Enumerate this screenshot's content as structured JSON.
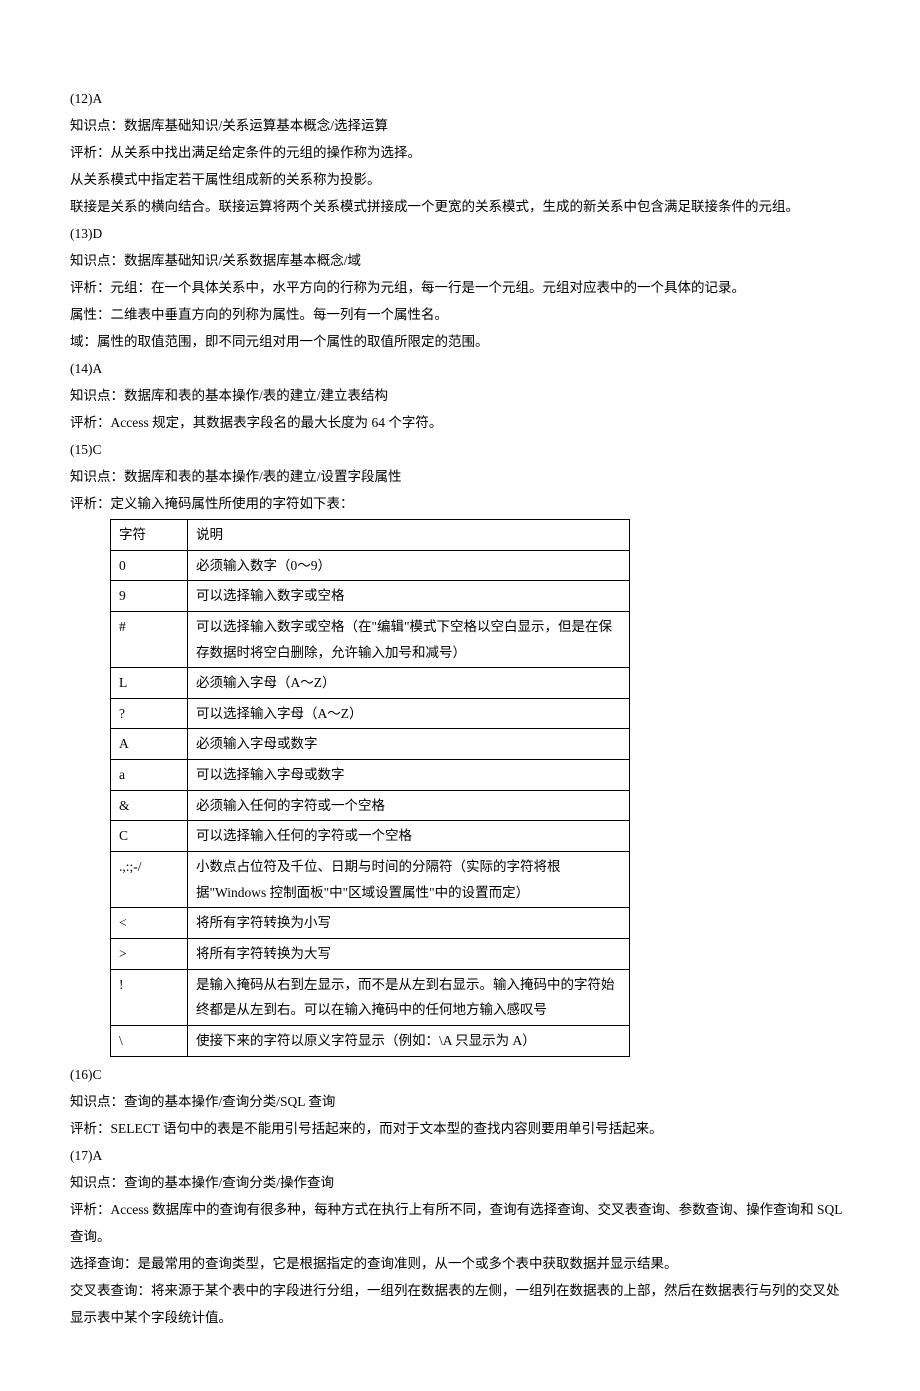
{
  "paragraphs_before_table": [
    "(12)A",
    "知识点：数据库基础知识/关系运算基本概念/选择运算",
    "评析：从关系中找出满足给定条件的元组的操作称为选择。",
    "从关系模式中指定若干属性组成新的关系称为投影。",
    "联接是关系的横向结合。联接运算将两个关系模式拼接成一个更宽的关系模式，生成的新关系中包含满足联接条件的元组。",
    "(13)D",
    "知识点：数据库基础知识/关系数据库基本概念/域",
    "评析：元组：在一个具体关系中，水平方向的行称为元组，每一行是一个元组。元组对应表中的一个具体的记录。",
    "属性：二维表中垂直方向的列称为属性。每一列有一个属性名。",
    "域：属性的取值范围，即不同元组对用一个属性的取值所限定的范围。",
    "(14)A",
    "知识点：数据库和表的基本操作/表的建立/建立表结构",
    "评析：Access 规定，其数据表字段名的最大长度为 64 个字符。",
    "(15)C",
    "知识点：数据库和表的基本操作/表的建立/设置字段属性",
    "评析：定义输入掩码属性所使用的字符如下表："
  ],
  "table": {
    "headers": [
      "字符",
      "说明"
    ],
    "rows": [
      [
        "0",
        "必须输入数字（0～9）"
      ],
      [
        "9",
        "可以选择输入数字或空格"
      ],
      [
        "#",
        "可以选择输入数字或空格（在\"编辑\"模式下空格以空白显示，但是在保存数据时将空白删除，允许输入加号和减号）"
      ],
      [
        "L",
        "必须输入字母（A～Z）"
      ],
      [
        "?",
        "可以选择输入字母（A～Z）"
      ],
      [
        "A",
        "必须输入字母或数字"
      ],
      [
        "a",
        "可以选择输入字母或数字"
      ],
      [
        "&",
        "必须输入任何的字符或一个空格"
      ],
      [
        "C",
        "可以选择输入任何的字符或一个空格"
      ],
      [
        ".,:;-/",
        "小数点占位符及千位、日期与时间的分隔符（实际的字符将根据\"Windows 控制面板\"中\"区域设置属性\"中的设置而定）"
      ],
      [
        "<",
        "将所有字符转换为小写"
      ],
      [
        ">",
        "将所有字符转换为大写"
      ],
      [
        "!",
        "是输入掩码从右到左显示，而不是从左到右显示。输入掩码中的字符始终都是从左到右。可以在输入掩码中的任何地方输入感叹号"
      ],
      [
        "\\",
        "使接下来的字符以原义字符显示（例如：\\A 只显示为 A）"
      ]
    ]
  },
  "paragraphs_after_table": [
    "(16)C",
    "知识点：查询的基本操作/查询分类/SQL 查询",
    "评析：SELECT 语句中的表是不能用引号括起来的，而对于文本型的查找内容则要用单引号括起来。",
    "(17)A",
    "知识点：查询的基本操作/查询分类/操作查询",
    "评析：Access 数据库中的查询有很多种，每种方式在执行上有所不同，查询有选择查询、交叉表查询、参数查询、操作查询和 SQL 查询。",
    "选择查询：是最常用的查询类型，它是根据指定的查询准则，从一个或多个表中获取数据并显示结果。",
    "交叉表查询：将来源于某个表中的字段进行分组，一组列在数据表的左侧，一组列在数据表的上部，然后在数据表行与列的交叉处显示表中某个字段统计值。"
  ]
}
